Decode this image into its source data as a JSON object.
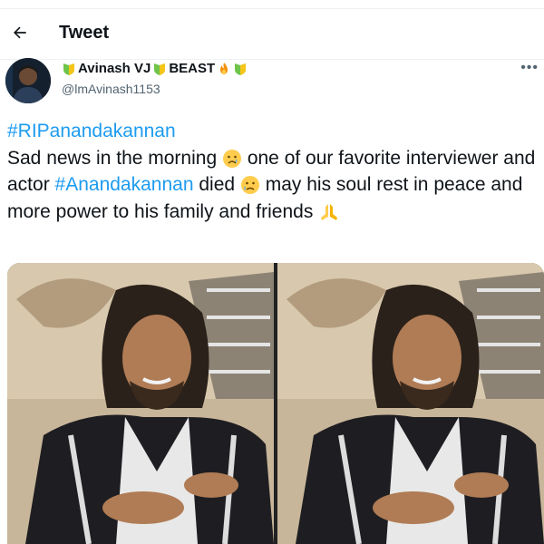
{
  "header": {
    "title": "Tweet"
  },
  "user": {
    "name_part1": "Avinash VJ",
    "name_part2": "BEAST",
    "handle": "@lmAvinash1153"
  },
  "tweet": {
    "hashtag1": "#RIPanandakannan",
    "text1": "Sad news in the morning",
    "text2": "one of our favorite interviewer and actor",
    "hashtag2": "#Anandakannan",
    "text3": "died",
    "text4": "may his soul rest in peace and more power to his family and friends"
  },
  "colors": {
    "link": "#1d9bf0",
    "muted": "#536471",
    "text": "#0f1419"
  },
  "icons": [
    "back-arrow-icon",
    "badge-icon",
    "fire-icon",
    "more-icon",
    "crying-face-icon",
    "sad-face-icon",
    "folded-hands-icon"
  ]
}
